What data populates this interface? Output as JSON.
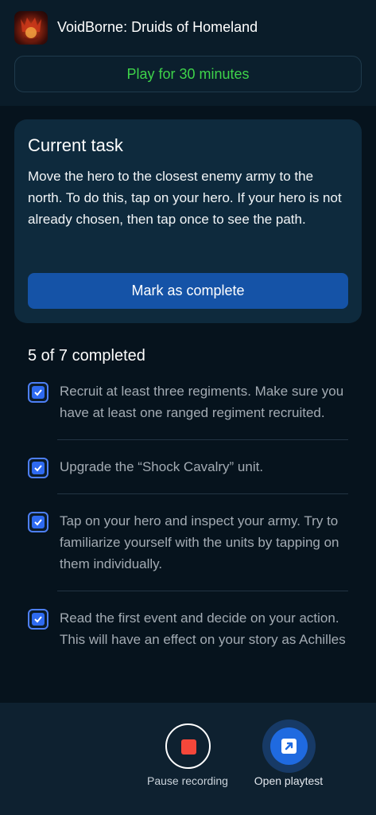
{
  "header": {
    "app_title": "VoidBorne: Druids of Homeland",
    "play_label": "Play for 30 minutes"
  },
  "task": {
    "title": "Current task",
    "description": "Move the hero to the closest enemy army to the north. To do this, tap on your hero. If your hero is not already chosen, then tap once to see the path.",
    "mark_label": "Mark as complete"
  },
  "progress": {
    "label": "5 of 7 completed"
  },
  "checklist": [
    {
      "text": "Recruit at least three regiments. Make sure you have at least one ranged regiment recruited.",
      "checked": true
    },
    {
      "text": "Upgrade the “Shock Cavalry” unit.",
      "checked": true
    },
    {
      "text": "Tap on your hero and inspect your army. Try to familiarize yourself with the units by tapping on them individually.",
      "checked": true
    },
    {
      "text": "Read the first event and decide on your action. This will have an effect on your story as Achilles",
      "checked": true
    }
  ],
  "bottom": {
    "pause_label": "Pause recording",
    "open_label": "Open playtest"
  },
  "colors": {
    "accent": "#1553a7",
    "play_green": "#3ed34a",
    "record_red": "#f5473a",
    "checkbox_blue": "#2e6af0"
  }
}
